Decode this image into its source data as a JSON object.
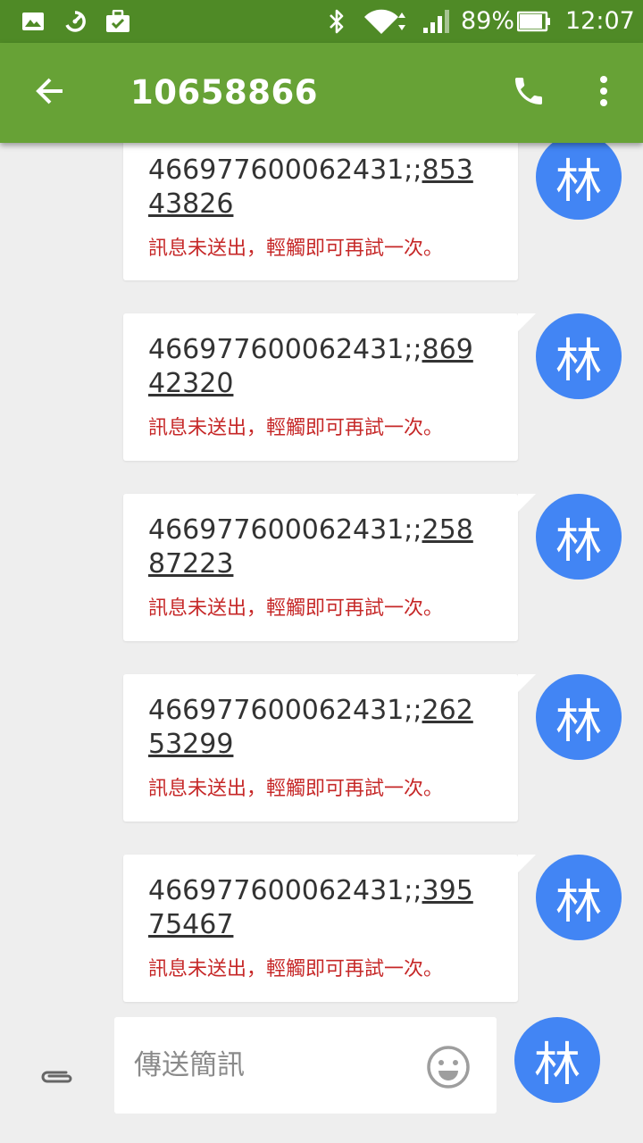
{
  "status_bar": {
    "left_icons": [
      "photo-icon",
      "speed-icon",
      "briefcase-check-icon"
    ],
    "right_icons": [
      "bluetooth-icon",
      "wifi-icon",
      "signal-icon",
      "battery-icon"
    ],
    "battery": "89%",
    "time": "12:07"
  },
  "app_bar": {
    "title": "10658866",
    "back_icon": "arrow-back-icon",
    "call_icon": "phone-icon",
    "menu_icon": "more-vert-icon"
  },
  "messages": [
    {
      "prefix": "466977600062431;;",
      "link": "85343826",
      "error": "訊息未送出，輕觸即可再試一次。",
      "avatar": "林"
    },
    {
      "prefix": "466977600062431;;",
      "link": "86942320",
      "error": "訊息未送出，輕觸即可再試一次。",
      "avatar": "林"
    },
    {
      "prefix": "466977600062431;;",
      "link": "25887223",
      "error": "訊息未送出，輕觸即可再試一次。",
      "avatar": "林"
    },
    {
      "prefix": "466977600062431;;",
      "link": "26253299",
      "error": "訊息未送出，輕觸即可再試一次。",
      "avatar": "林"
    },
    {
      "prefix": "466977600062431;;",
      "link": "39575467",
      "error": "訊息未送出，輕觸即可再試一次。",
      "avatar": "林"
    }
  ],
  "compose": {
    "placeholder": "傳送簡訊",
    "value": "",
    "attach_icon": "attachment-icon",
    "emoji_icon": "emoji-icon",
    "sender_avatar": "林"
  },
  "colors": {
    "status_bar": "#4f8a26",
    "app_bar": "#67a236",
    "avatar": "#4285f4",
    "error_text": "#c62828",
    "background": "#eeeeee"
  }
}
